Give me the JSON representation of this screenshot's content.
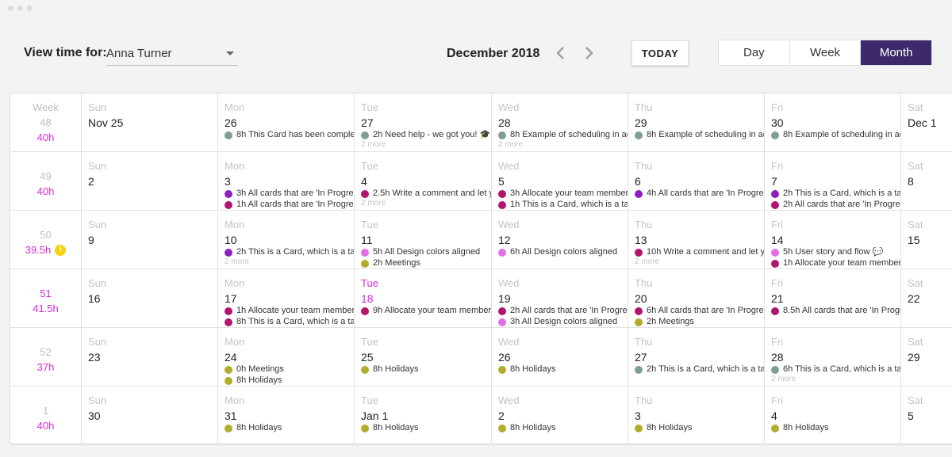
{
  "header": {
    "view_time_label": "View time for:",
    "user_selected": "Anna Turner",
    "month_title": "December 2018",
    "today_label": "TODAY",
    "views": [
      "Day",
      "Week",
      "Month"
    ],
    "active_view": "Month"
  },
  "colors": {
    "accent": "#3d2a6b",
    "today": "#d62bd6",
    "event_green": "#7fa08e",
    "event_purple": "#8e1fbf",
    "event_magenta": "#b0166e",
    "event_pink": "#e36fe8",
    "event_olive": "#b1ac2c"
  },
  "calendar": {
    "week_label": "Week",
    "weeks": [
      {
        "week": "48",
        "hours": "40h",
        "warning": false,
        "days": [
          {
            "name": "Sun",
            "num": "Nov 25",
            "events": [],
            "more": ""
          },
          {
            "name": "Mon",
            "num": "26",
            "events": [
              {
                "color": "#7fa08e",
                "text": "8h This Card has been completed"
              }
            ],
            "more": ""
          },
          {
            "name": "Tue",
            "num": "27",
            "events": [
              {
                "color": "#7fa08e",
                "text": "2h Need help - we got you! 🎓"
              }
            ],
            "more": "2 more"
          },
          {
            "name": "Wed",
            "num": "28",
            "events": [
              {
                "color": "#7fa08e",
                "text": "8h Example of scheduling in ac"
              }
            ],
            "more": "2 more"
          },
          {
            "name": "Thu",
            "num": "29",
            "events": [
              {
                "color": "#7fa08e",
                "text": "8h Example of scheduling in ac"
              }
            ],
            "more": ""
          },
          {
            "name": "Fri",
            "num": "30",
            "events": [
              {
                "color": "#7fa08e",
                "text": "8h Example of scheduling in ac"
              }
            ],
            "more": ""
          },
          {
            "name": "Sat",
            "num": "Dec 1",
            "events": [],
            "more": ""
          }
        ]
      },
      {
        "week": "49",
        "hours": "40h",
        "warning": false,
        "days": [
          {
            "name": "Sun",
            "num": "2",
            "events": [],
            "more": ""
          },
          {
            "name": "Mon",
            "num": "3",
            "events": [
              {
                "color": "#8e1fbf",
                "text": "3h All cards that are 'In Progress'"
              },
              {
                "color": "#b0166e",
                "text": "1h All cards that are 'In Progress'"
              }
            ],
            "more": ""
          },
          {
            "name": "Tue",
            "num": "4",
            "events": [
              {
                "color": "#b0166e",
                "text": "2.5h Write a comment and let y"
              }
            ],
            "more": "2 more"
          },
          {
            "name": "Wed",
            "num": "5",
            "events": [
              {
                "color": "#b0166e",
                "text": "3h Allocate your team member"
              },
              {
                "color": "#b0166e",
                "text": "1h This is a Card, which is a tas"
              }
            ],
            "more": ""
          },
          {
            "name": "Thu",
            "num": "6",
            "events": [
              {
                "color": "#8e1fbf",
                "text": "4h All cards that are 'In Progres"
              }
            ],
            "more": ""
          },
          {
            "name": "Fri",
            "num": "7",
            "events": [
              {
                "color": "#8e1fbf",
                "text": "2h This is a Card, which is a tas"
              },
              {
                "color": "#b0166e",
                "text": "2h All cards that are 'In Progres"
              }
            ],
            "more": ""
          },
          {
            "name": "Sat",
            "num": "8",
            "events": [],
            "more": ""
          }
        ]
      },
      {
        "week": "50",
        "hours": "39.5h",
        "warning": true,
        "days": [
          {
            "name": "Sun",
            "num": "9",
            "events": [],
            "more": ""
          },
          {
            "name": "Mon",
            "num": "10",
            "events": [
              {
                "color": "#8e1fbf",
                "text": "2h This is a Card, which is a tas"
              }
            ],
            "more": "2 more"
          },
          {
            "name": "Tue",
            "num": "11",
            "events": [
              {
                "color": "#e36fe8",
                "text": "5h All Design colors aligned"
              },
              {
                "color": "#b1ac2c",
                "text": "2h Meetings"
              }
            ],
            "more": ""
          },
          {
            "name": "Wed",
            "num": "12",
            "events": [
              {
                "color": "#e36fe8",
                "text": "6h All Design colors aligned"
              }
            ],
            "more": ""
          },
          {
            "name": "Thu",
            "num": "13",
            "events": [
              {
                "color": "#b0166e",
                "text": "10h Write a comment and let yo"
              }
            ],
            "more": "2 more"
          },
          {
            "name": "Fri",
            "num": "14",
            "events": [
              {
                "color": "#e36fe8",
                "text": "5h User story and flow 💬"
              },
              {
                "color": "#b0166e",
                "text": "1h Allocate your team member"
              }
            ],
            "more": ""
          },
          {
            "name": "Sat",
            "num": "15",
            "events": [],
            "more": ""
          }
        ]
      },
      {
        "week": "51",
        "hours": "41.5h",
        "warning": false,
        "current": true,
        "days": [
          {
            "name": "Sun",
            "num": "16",
            "events": [],
            "more": ""
          },
          {
            "name": "Mon",
            "num": "17",
            "events": [
              {
                "color": "#b0166e",
                "text": "1h Allocate your team member"
              },
              {
                "color": "#b0166e",
                "text": "8h This is a Card, which is a tas"
              }
            ],
            "more": ""
          },
          {
            "name": "Tue",
            "num": "18",
            "today": true,
            "events": [
              {
                "color": "#b0166e",
                "text": "9h Allocate your team member"
              }
            ],
            "more": ""
          },
          {
            "name": "Wed",
            "num": "19",
            "events": [
              {
                "color": "#b0166e",
                "text": "2h All cards that are 'In Progres"
              },
              {
                "color": "#e36fe8",
                "text": "3h All Design colors aligned"
              }
            ],
            "more": ""
          },
          {
            "name": "Thu",
            "num": "20",
            "events": [
              {
                "color": "#b0166e",
                "text": "6h All cards that are 'In Progres"
              },
              {
                "color": "#b1ac2c",
                "text": "2h Meetings"
              }
            ],
            "more": ""
          },
          {
            "name": "Fri",
            "num": "21",
            "events": [
              {
                "color": "#b0166e",
                "text": "8.5h All cards that are 'In Progre"
              }
            ],
            "more": ""
          },
          {
            "name": "Sat",
            "num": "22",
            "events": [],
            "more": ""
          }
        ]
      },
      {
        "week": "52",
        "hours": "37h",
        "warning": false,
        "days": [
          {
            "name": "Sun",
            "num": "23",
            "events": [],
            "more": ""
          },
          {
            "name": "Mon",
            "num": "24",
            "events": [
              {
                "color": "#b1ac2c",
                "text": "0h Meetings"
              },
              {
                "color": "#b1ac2c",
                "text": "8h Holidays"
              }
            ],
            "more": ""
          },
          {
            "name": "Tue",
            "num": "25",
            "events": [
              {
                "color": "#b1ac2c",
                "text": "8h Holidays"
              }
            ],
            "more": ""
          },
          {
            "name": "Wed",
            "num": "26",
            "events": [
              {
                "color": "#b1ac2c",
                "text": "8h Holidays"
              }
            ],
            "more": ""
          },
          {
            "name": "Thu",
            "num": "27",
            "events": [
              {
                "color": "#7fa08e",
                "text": "2h This is a Card, which is a tas"
              }
            ],
            "more": ""
          },
          {
            "name": "Fri",
            "num": "28",
            "events": [
              {
                "color": "#7fa08e",
                "text": "6h This is a Card, which is a tas"
              }
            ],
            "more": "2 more"
          },
          {
            "name": "Sat",
            "num": "29",
            "events": [],
            "more": ""
          }
        ]
      },
      {
        "week": "1",
        "hours": "40h",
        "warning": false,
        "days": [
          {
            "name": "Sun",
            "num": "30",
            "events": [],
            "more": ""
          },
          {
            "name": "Mon",
            "num": "31",
            "events": [
              {
                "color": "#b1ac2c",
                "text": "8h Holidays"
              }
            ],
            "more": ""
          },
          {
            "name": "Tue",
            "num": "Jan 1",
            "events": [
              {
                "color": "#b1ac2c",
                "text": "8h Holidays"
              }
            ],
            "more": ""
          },
          {
            "name": "Wed",
            "num": "2",
            "events": [
              {
                "color": "#b1ac2c",
                "text": "8h Holidays"
              }
            ],
            "more": ""
          },
          {
            "name": "Thu",
            "num": "3",
            "events": [
              {
                "color": "#b1ac2c",
                "text": "8h Holidays"
              }
            ],
            "more": ""
          },
          {
            "name": "Fri",
            "num": "4",
            "events": [
              {
                "color": "#b1ac2c",
                "text": "8h Holidays"
              }
            ],
            "more": ""
          },
          {
            "name": "Sat",
            "num": "5",
            "events": [],
            "more": ""
          }
        ]
      }
    ]
  }
}
